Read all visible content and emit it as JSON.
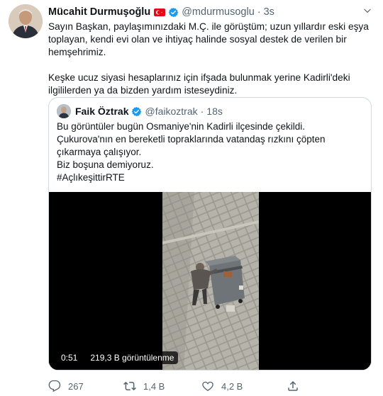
{
  "tweet": {
    "author_name": "Mücahit Durmuşoğlu",
    "author_handle": "@mdurmusoglu",
    "separator": "·",
    "time": "3s",
    "text_paragraph_1": "Sayın Başkan, paylaşımınızdaki M.Ç. ile görüştüm; uzun yıllardır eski eşya\ntoplayan, kendi evi olan ve ihtiyaç halinde sosyal destek de verilen bir\nhemşehrimiz.",
    "text_paragraph_2": "Keşke ucuz siyasi hesaplarınız için ifşada bulunmak yerine Kadirli'deki\nilgililerden ya da bizden yardım isteseydiniz."
  },
  "quote": {
    "author_name": "Faik Öztrak",
    "author_handle": "@faikoztrak",
    "separator": "·",
    "time": "18s",
    "text": "Bu görüntüler bugün Osmaniye'nin Kadirli ilçesinde çekildi.\nÇukurova'nın en bereketli topraklarında vatandaş rızkını çöpten\nçıkarmaya çalışıyor.\nBiz boşuna demiyoruz.\n#AçlıkeşittirRTE",
    "video": {
      "duration": "0:51",
      "views": "219,3 B görüntülenme"
    }
  },
  "actions": {
    "reply_count": "267",
    "retweet_count": "1,4 B",
    "like_count": "4,2 B"
  },
  "colors": {
    "verified": "#1d9bf0",
    "secondary_text": "#536471",
    "flag": "#e30a17"
  }
}
